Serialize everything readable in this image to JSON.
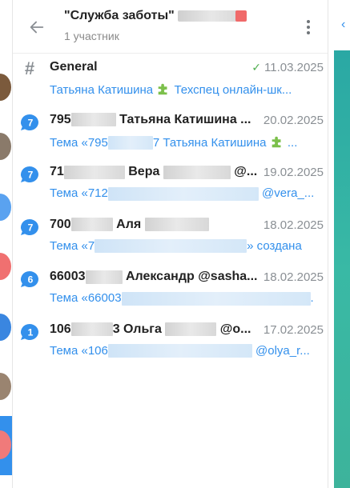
{
  "header": {
    "title": "\"Служба заботы\"",
    "subtitle": "1 участник"
  },
  "topics": [
    {
      "type": "general",
      "title": "General",
      "date": "11.03.2025",
      "read": true,
      "preview_prefix": "Татьяна Катишина",
      "preview_suffix": "Техспец онлайн-шк..."
    },
    {
      "unread": "7",
      "title_prefix": "795",
      "title_suffix": "Татьяна Катишина ...",
      "date": "20.02.2025",
      "preview_prefix": "Тема «795",
      "preview_mid": "7 Татьяна Катишина",
      "preview_suffix": "..."
    },
    {
      "unread": "7",
      "title_prefix": "71",
      "title_mid": "Вера",
      "title_suffix": "@...",
      "date": "19.02.2025",
      "preview_prefix": "Тема «712",
      "preview_suffix": "@vera_..."
    },
    {
      "unread": "7",
      "title_prefix": "700",
      "title_mid": "Аля",
      "date": "18.02.2025",
      "preview_prefix": "Тема «7",
      "preview_suffix": "» создана"
    },
    {
      "unread": "6",
      "title_prefix": "66003",
      "title_mid": "Александр @sasha...",
      "date": "18.02.2025",
      "preview_prefix": "Тема «66003",
      "preview_suffix": "."
    },
    {
      "unread": "1",
      "title_prefix": "106",
      "title_mid": "3 Ольга",
      "title_suffix": "@о...",
      "date": "17.02.2025",
      "preview_prefix": "Тема «106",
      "preview_suffix": "@olya_r..."
    }
  ],
  "colors": {
    "accent": "#3390ec",
    "read_check": "#4fae4e",
    "muted": "#8a8f94"
  }
}
